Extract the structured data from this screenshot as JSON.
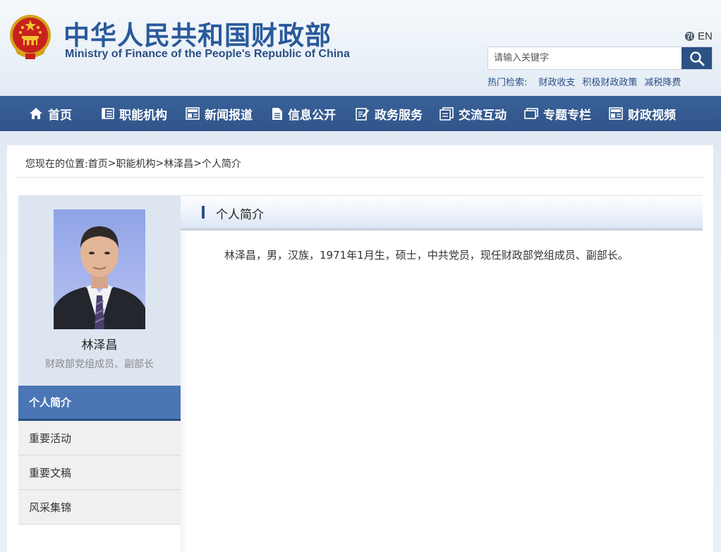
{
  "header": {
    "site_name_cn": "中华人民共和国财政部",
    "site_name_en": "Ministry of Finance of the People's Republic of China",
    "emblem_icon": "national-emblem-icon",
    "lang_label": "EN",
    "search_placeholder": "请输入关键字",
    "hot_label": "热门检索:",
    "hot_items": [
      "财政收支",
      "积极财政政策",
      "减税降费"
    ]
  },
  "nav": {
    "items": [
      {
        "label": "首页",
        "icon": "home-icon"
      },
      {
        "label": "职能机构",
        "icon": "list-icon"
      },
      {
        "label": "新闻报道",
        "icon": "news-icon"
      },
      {
        "label": "信息公开",
        "icon": "document-icon"
      },
      {
        "label": "政务服务",
        "icon": "edit-icon"
      },
      {
        "label": "交流互动",
        "icon": "copy-icon"
      },
      {
        "label": "专题专栏",
        "icon": "window-icon"
      },
      {
        "label": "财政视频",
        "icon": "video-icon"
      }
    ]
  },
  "breadcrumb": {
    "prefix": "您现在的位置:",
    "items": [
      "首页",
      "职能机构",
      "林泽昌",
      "个人简介"
    ],
    "separator": ">"
  },
  "profile": {
    "name": "林泽昌",
    "title": "财政部党组成员、副部长"
  },
  "side_menu": {
    "items": [
      "个人简介",
      "重要活动",
      "重要文稿",
      "风采集锦"
    ],
    "active_index": 0
  },
  "content": {
    "title": "个人简介",
    "body": "林泽昌，男，汉族，1971年1月生，硕士，中共党员，现任财政部党组成员、副部长。"
  },
  "colors": {
    "nav_bg": "#2f5589",
    "accent": "#4a76b6",
    "brand_text": "#2a5a9b"
  }
}
